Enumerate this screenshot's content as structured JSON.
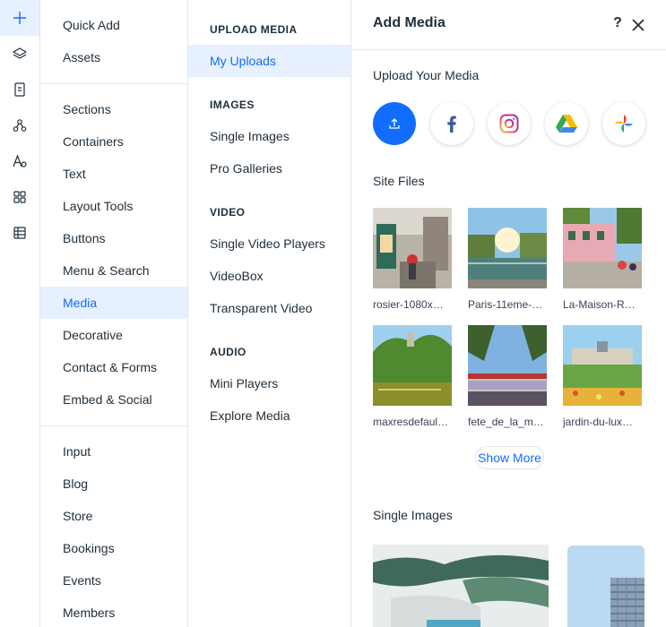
{
  "rail": {
    "items": [
      {
        "icon": "plus-icon",
        "active": true
      },
      {
        "icon": "layers-icon"
      },
      {
        "icon": "page-icon"
      },
      {
        "icon": "nodes-icon"
      },
      {
        "icon": "text-theme-icon"
      },
      {
        "icon": "apps-grid-icon"
      },
      {
        "icon": "table-icon"
      }
    ]
  },
  "categories": {
    "group1": [
      "Quick Add",
      "Assets"
    ],
    "group2": [
      "Sections",
      "Containers",
      "Text",
      "Layout Tools",
      "Buttons",
      "Menu & Search",
      "Media",
      "Decorative",
      "Contact & Forms",
      "Embed & Social"
    ],
    "group3": [
      "Input",
      "Blog",
      "Store",
      "Bookings",
      "Events",
      "Members"
    ],
    "active": "Media"
  },
  "subcategories": {
    "upload_heading": "UPLOAD MEDIA",
    "upload_items": [
      "My Uploads"
    ],
    "images_heading": "IMAGES",
    "images_items": [
      "Single Images",
      "Pro Galleries"
    ],
    "video_heading": "VIDEO",
    "video_items": [
      "Single Video Players",
      "VideoBox",
      "Transparent Video"
    ],
    "audio_heading": "AUDIO",
    "audio_items": [
      "Mini Players",
      "Explore Media"
    ],
    "active": "My Uploads"
  },
  "panel": {
    "title": "Add Media",
    "help_label": "?",
    "upload_title": "Upload Your Media",
    "sources": [
      {
        "icon": "upload-icon"
      },
      {
        "icon": "facebook-icon"
      },
      {
        "icon": "instagram-icon"
      },
      {
        "icon": "google-drive-icon"
      },
      {
        "icon": "google-photos-icon"
      }
    ],
    "site_files_title": "Site Files",
    "site_files": [
      {
        "label": "rosier-1080x…"
      },
      {
        "label": "Paris-11eme-…"
      },
      {
        "label": "La-Maison-R…"
      },
      {
        "label": "maxresdefaul…"
      },
      {
        "label": "fete_de_la_m…"
      },
      {
        "label": "jardin-du-lux…"
      }
    ],
    "show_more_label": "Show More",
    "single_images_title": "Single Images"
  },
  "colors": {
    "accent": "#116dff",
    "selected_bg": "#e7f0ff",
    "text": "#20303c",
    "divider": "#dfe5eb"
  }
}
